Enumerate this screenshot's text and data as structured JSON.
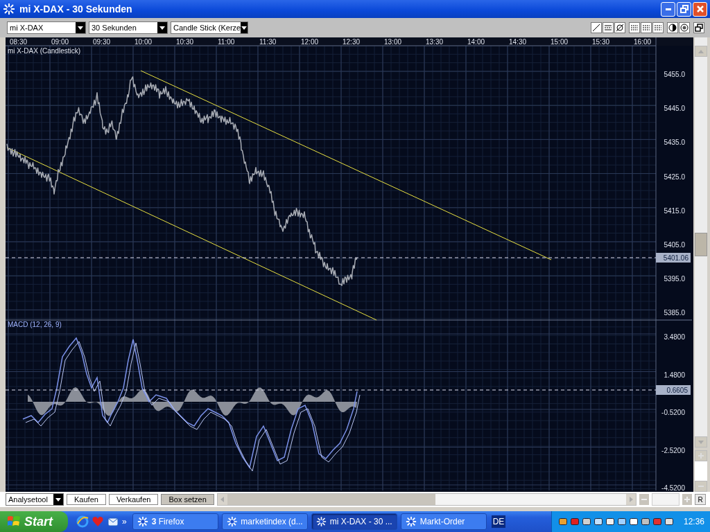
{
  "window": {
    "title": "mi X-DAX - 30 Sekunden"
  },
  "toolbar": {
    "dropdowns": [
      {
        "value": "mi X-DAX"
      },
      {
        "value": "30 Sekunden"
      },
      {
        "value": "Candle Stick (Kerze"
      }
    ]
  },
  "chart": {
    "time_labels": [
      "08:30",
      "09:00",
      "09:30",
      "10:00",
      "10:30",
      "11:00",
      "11:30",
      "12:00",
      "12:30",
      "13:00",
      "13:30",
      "14:00",
      "14:30",
      "15:00",
      "15:30",
      "16:00"
    ],
    "price_title": "mi X-DAX (Candlestick)",
    "price_labels": [
      "5455.0",
      "5445.0",
      "5435.0",
      "5425.0",
      "5415.0",
      "5405.0",
      "5395.0",
      "5385.0"
    ],
    "price_marker": "5401.06",
    "macd_title": "MACD (12, 26, 9)",
    "macd_labels": [
      "3.4800",
      "1.4800",
      "-0.5200",
      "-2.5200",
      "-4.5200"
    ],
    "macd_marker": "0.6605"
  },
  "bottom_bar": {
    "dropdown": "Analysetool",
    "buttons": [
      {
        "label": "Kaufen",
        "selected": false
      },
      {
        "label": "Verkaufen",
        "selected": false
      },
      {
        "label": "Box setzen",
        "selected": true
      }
    ],
    "reset_label": "R"
  },
  "taskbar": {
    "start": "Start",
    "more": "»",
    "tasks": [
      {
        "label": "**3** Firefox",
        "selected": false
      },
      {
        "label": "marketindex (d...",
        "selected": false
      },
      {
        "label": "mi X-DAX - 30 ...",
        "selected": true
      },
      {
        "label": "Markt-Order",
        "selected": false
      }
    ],
    "language": "DE",
    "clock": "12:36"
  }
}
